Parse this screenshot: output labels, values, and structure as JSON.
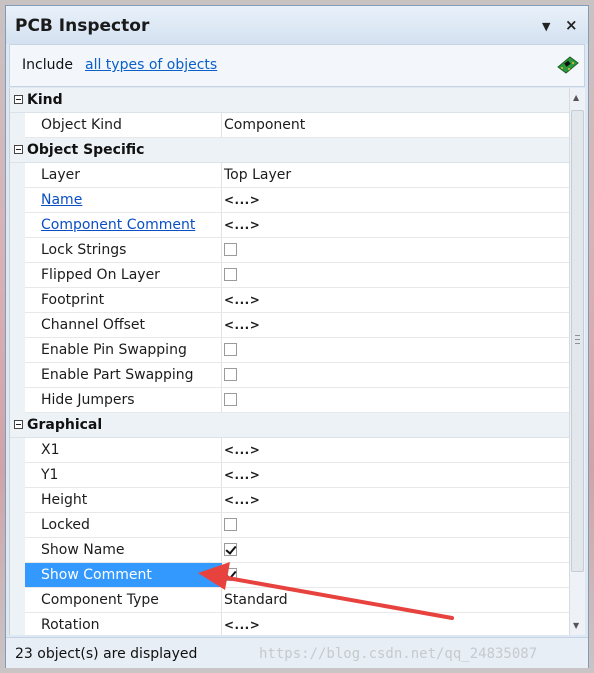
{
  "window": {
    "title": "PCB Inspector"
  },
  "titlebar": {
    "pin_icon": "pin-dropdown-icon",
    "close_icon": "close-icon"
  },
  "include": {
    "label": "Include",
    "link": "all types of objects",
    "icon": "pcb-board-icon"
  },
  "categories": {
    "kind": "Kind",
    "object_specific": "Object Specific",
    "graphical": "Graphical"
  },
  "rows": [
    {
      "label": "Object Kind",
      "value": "Component"
    },
    {
      "label": "Layer",
      "value": "Top Layer"
    },
    {
      "label": "Name",
      "value": "<...>"
    },
    {
      "label": "Component Comment",
      "value": "<...>"
    },
    {
      "label": "Lock Strings",
      "checked": false
    },
    {
      "label": "Flipped On Layer",
      "checked": false
    },
    {
      "label": "Footprint",
      "value": "<...>"
    },
    {
      "label": "Channel Offset",
      "value": "<...>"
    },
    {
      "label": "Enable Pin Swapping",
      "checked": false
    },
    {
      "label": "Enable Part Swapping",
      "checked": false
    },
    {
      "label": "Hide Jumpers",
      "checked": false
    },
    {
      "label": "X1",
      "value": "<...>"
    },
    {
      "label": "Y1",
      "value": "<...>"
    },
    {
      "label": "Height",
      "value": "<...>"
    },
    {
      "label": "Locked",
      "checked": false
    },
    {
      "label": "Show Name",
      "checked": true
    },
    {
      "label": "Show Comment",
      "checked": true,
      "selected": true
    },
    {
      "label": "Component Type",
      "value": "Standard"
    },
    {
      "label": "Rotation",
      "value": "<...>"
    }
  ],
  "status": {
    "text": "23 object(s) are displayed",
    "watermark": "https://blog.csdn.net/qq_24835087"
  },
  "colors": {
    "selection": "#3399ff",
    "link": "#0b5fc9",
    "annotation_arrow": "#e8423f"
  }
}
